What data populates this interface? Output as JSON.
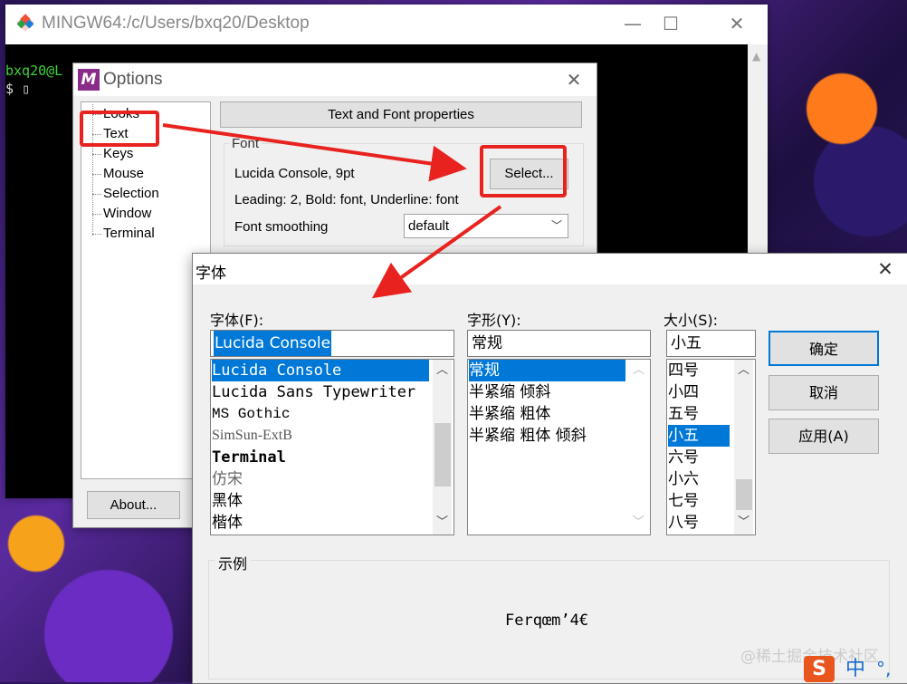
{
  "bash_window": {
    "title": "MINGW64:/c/Users/bxq20/Desktop",
    "terminal_line1": "bxq20@L",
    "terminal_line2": "$ ▯"
  },
  "options_dialog": {
    "title": "Options",
    "icon_letter": "M",
    "nav_items": [
      "Looks",
      "Text",
      "Keys",
      "Mouse",
      "Selection",
      "Window",
      "Terminal"
    ],
    "section_button": "Text and Font properties",
    "font_group_label": "Font",
    "font_value": "Lucida Console, 9pt",
    "select_button": "Select...",
    "font_details": "Leading: 2, Bold: font, Underline: font",
    "smoothing_label": "Font smoothing",
    "smoothing_value": "default",
    "about_button": "About..."
  },
  "font_dialog": {
    "title": "字体",
    "font_label": "字体(F):",
    "font_input": "Lucida Console",
    "font_list": [
      "Lucida Console",
      "Lucida Sans Typewriter",
      "MS Gothic",
      "SimSun-ExtB",
      "Terminal",
      "仿宋",
      "黑体",
      "楷体"
    ],
    "style_label": "字形(Y):",
    "style_input": "常规",
    "style_list": [
      "常规",
      "半紧缩 倾斜",
      "半紧缩 粗体",
      "半紧缩 粗体 倾斜"
    ],
    "size_label": "大小(S):",
    "size_input": "小五",
    "size_list": [
      "四号",
      "小四",
      "五号",
      "小五",
      "六号",
      "小六",
      "七号",
      "八号"
    ],
    "ok_button": "确定",
    "cancel_button": "取消",
    "apply_button": "应用(A)",
    "sample_label": "示例",
    "sample_text": "Ferqœm’4€"
  },
  "overlay": {
    "watermark": "@稀土掘金技术社区",
    "ime_badge": "S",
    "ime_lang": "中",
    "ime_dots": "°,"
  },
  "colors": {
    "annotation_red": "#e8231f",
    "selection_blue": "#0078d7",
    "terminal_green": "#3fd33f"
  }
}
